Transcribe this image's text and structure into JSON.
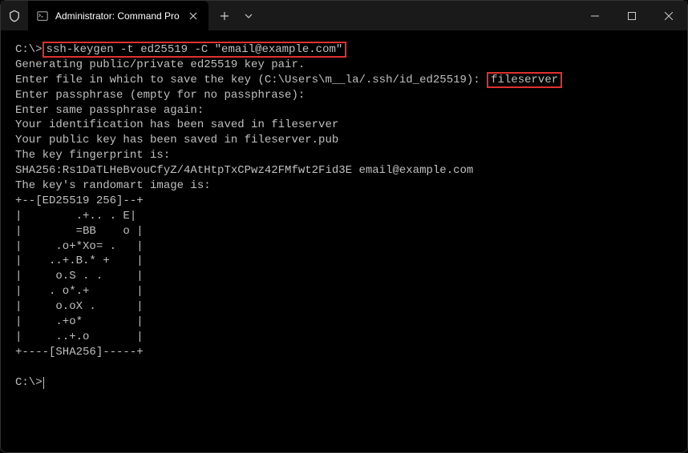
{
  "titlebar": {
    "tab_title": "Administrator: Command Pro"
  },
  "terminal": {
    "prompt1": "C:\\>",
    "command": "ssh-keygen -t ed25519 -C \"email@example.com\"",
    "line_generating": "Generating public/private ed25519 key pair.",
    "line_enter_file": "Enter file in which to save the key (C:\\Users\\m__la/.ssh/id_ed25519): ",
    "input_filename": "fileserver",
    "line_passphrase": "Enter passphrase (empty for no passphrase):",
    "line_passphrase_again": "Enter same passphrase again:",
    "line_id_saved": "Your identification has been saved in fileserver",
    "line_pubkey_saved": "Your public key has been saved in fileserver.pub",
    "line_fingerprint_header": "The key fingerprint is:",
    "line_fingerprint": "SHA256:Rs1DaTLHeBvouCfyZ/4AtHtpTxCPwz42FMfwt2Fid3E email@example.com",
    "line_randomart_header": "The key's randomart image is:",
    "randomart": [
      "+--[ED25519 256]--+",
      "|        .+.. . E|",
      "|        =BB    o |",
      "|     .o+*Xo= .   |",
      "|    ..+.B.* +    |",
      "|     o.S . .     |",
      "|    . o*.+       |",
      "|     o.oX .      |",
      "|     .+o*        |",
      "|     ..+.o       |",
      "+----[SHA256]-----+"
    ],
    "prompt2": "C:\\>"
  }
}
